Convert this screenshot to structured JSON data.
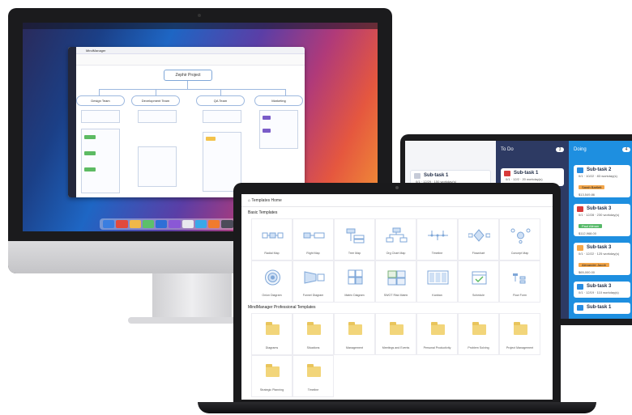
{
  "desktop_app": {
    "window_title": "MindManager",
    "root_topic": "Zephir Project",
    "branches": [
      "Design Team",
      "Development Team",
      "QA Team",
      "Marketing"
    ]
  },
  "kanban": {
    "columns": [
      {
        "name": "",
        "count": "",
        "color": "#f4f5f8",
        "text_color": "#8a8fa0"
      },
      {
        "name": "To Do",
        "count": "3",
        "color": "#2d3a63",
        "text_color": "#ffffff"
      },
      {
        "name": "Doing",
        "count": "4",
        "color": "#1e8fe0",
        "text_color": "#ffffff"
      }
    ],
    "cards": {
      "backlog": [
        {
          "title": "Sub-task 1",
          "line": "0/1 · 12/29 · 150 workday(s)"
        }
      ],
      "todo": [
        {
          "title": "Sub-task 1",
          "line": "0/1 · 12/2 · 20 workday(s)",
          "icon_color": "#d83a3a"
        }
      ],
      "doing": [
        {
          "title": "Sub-task 2",
          "line": "0/1 · 10/22 · 83 workday(s)",
          "tag": "Sarah Bartlett",
          "tag_color": "#f3a64a",
          "amount": "$13,549.86",
          "icon_color": "#2a8ce0"
        },
        {
          "title": "Sub-task 3",
          "line": "0/1 · 12/28 · 230 workday(s)",
          "tag": "Paul Allman",
          "tag_color": "#56b968",
          "amount": "$112,968.00",
          "icon_color": "#d83a3a"
        },
        {
          "title": "Sub-task 3",
          "line": "0/1 · 12/22 · 125 workday(s)",
          "tag": "Alexander Jacob",
          "tag_color": "#f3a64a",
          "amount": "$65,000.00",
          "icon_color": "#f3a64a"
        },
        {
          "title": "Sub-task 3",
          "line": "0/1 · 12/19 · 110 workday(s)",
          "tag": "",
          "tag_color": "",
          "amount": "",
          "icon_color": "#2a8ce0"
        },
        {
          "title": "Sub-task 1",
          "line": "",
          "tag": "",
          "tag_color": "",
          "amount": "",
          "icon_color": "#2a8ce0"
        }
      ]
    }
  },
  "templates": {
    "breadcrumb": "Templates Home",
    "basic_section": "Basic Templates",
    "basic": [
      "Radial Map",
      "Right Map",
      "Tree Map",
      "Org Chart Map",
      "Timeline",
      "Flowchart",
      "Concept Map",
      "Onion Diagram",
      "Funnel Diagram",
      "Matrix Diagram",
      "SWOT Risk Matrix",
      "Kanban",
      "Schedule",
      "Flow Form"
    ],
    "pro_section": "MindManager Professional Templates",
    "pro": [
      "Diagrams",
      "Situations",
      "Management",
      "Meetings and Events",
      "Personal Productivity",
      "Problem Solving",
      "Project Management",
      "Strategic Planning",
      "Timeline"
    ]
  },
  "colors": {
    "accent": "#1e8fe0",
    "navy": "#2d3a63",
    "folder": "#f2d57a"
  }
}
